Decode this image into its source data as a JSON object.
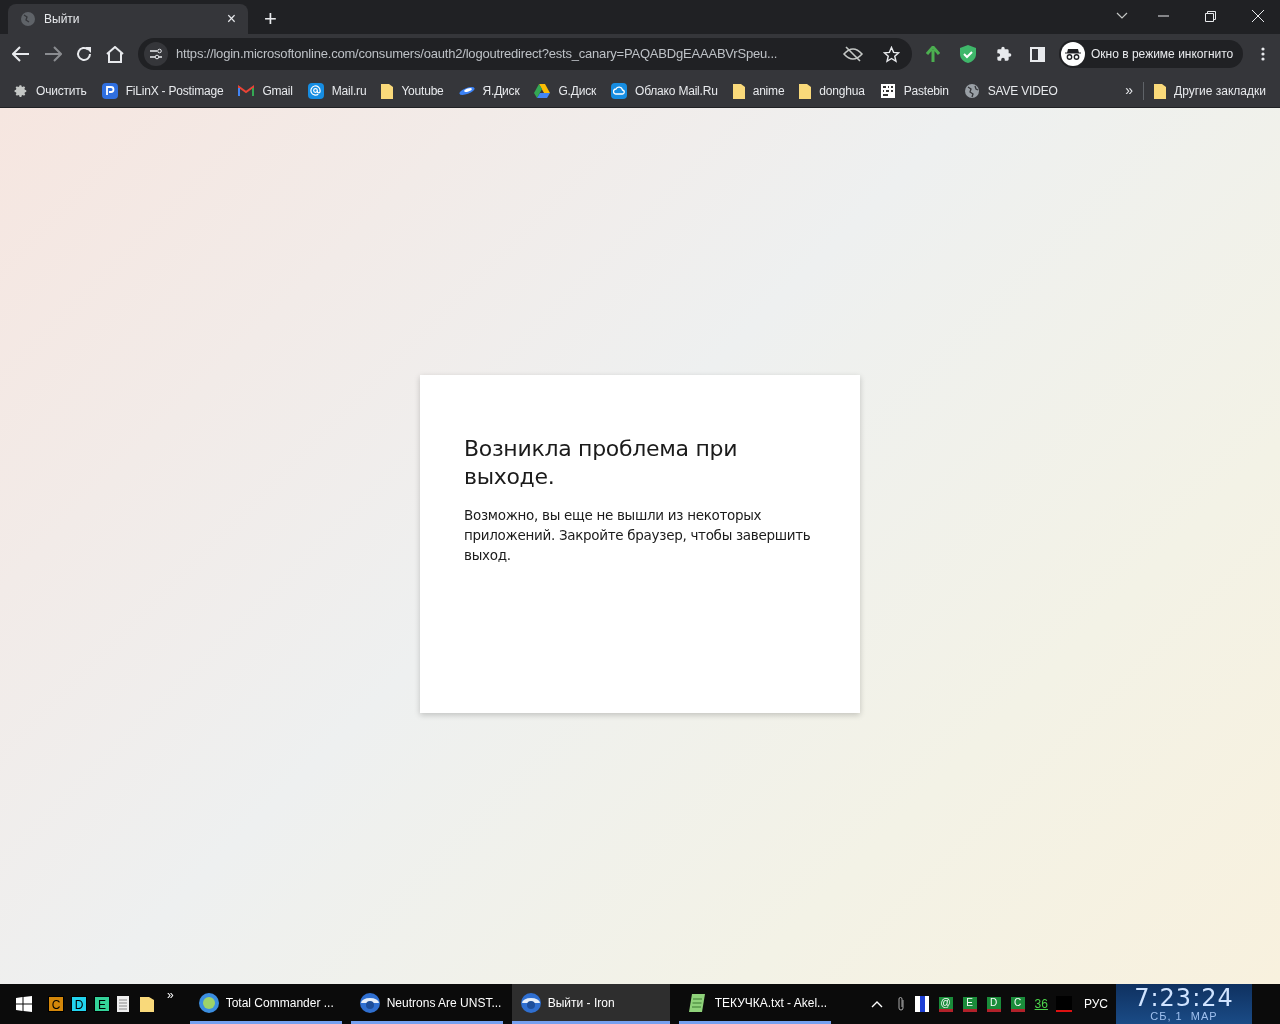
{
  "tabs": [
    {
      "title": "Выйти",
      "close": "×",
      "selected": true
    }
  ],
  "new_tab": "+",
  "address_bar": {
    "url": "https://login.microsoftonline.com/consumers/oauth2/logoutredirect?ests_canary=PAQABDgEAAABVrSpeu..."
  },
  "incognito_label": "Окно в режиме инкогнито",
  "bookmarks": [
    {
      "label": "Очистить",
      "kind": "gear"
    },
    {
      "label": "FiLinX - Postimage",
      "kind": "postimage"
    },
    {
      "label": "Gmail",
      "kind": "gmail"
    },
    {
      "label": "Mail.ru",
      "kind": "mailru"
    },
    {
      "label": "Youtube",
      "kind": "folder"
    },
    {
      "label": "Я.Диск",
      "kind": "ydisk"
    },
    {
      "label": "G.Диск",
      "kind": "gdrive"
    },
    {
      "label": "Облако Mail.Ru",
      "kind": "cloud"
    },
    {
      "label": "anime",
      "kind": "folder"
    },
    {
      "label": "donghua",
      "kind": "folder"
    },
    {
      "label": "Pastebin",
      "kind": "pastebin"
    },
    {
      "label": "SAVE VIDEO",
      "kind": "globe"
    }
  ],
  "bookmarks_overflow": "»",
  "other_bookmarks": "Другие закладки",
  "card": {
    "heading": "Возникла проблема при выходе.",
    "message": "Возможно, вы еще не вышли из некоторых приложений. Закройте браузер, чтобы завершить выход."
  },
  "taskbar": {
    "quick_launch": [
      {
        "label": "C",
        "color": "#d4870a"
      },
      {
        "label": "D",
        "color": "#22d3ee"
      },
      {
        "label": "E",
        "color": "#34d399"
      }
    ],
    "quick_overflow": "»",
    "windows": [
      {
        "title": "Total Commander ...",
        "kind": "tc",
        "selected": false
      },
      {
        "title": "Neutrons Are UNST...",
        "kind": "iron",
        "selected": false
      },
      {
        "title": "Выйти - Iron",
        "kind": "iron",
        "selected": true
      },
      {
        "title": "ТЕКУЧКА.txt - Akel...",
        "kind": "notepad",
        "selected": false
      }
    ],
    "tray_drives": [
      "@",
      "E",
      "D",
      "C"
    ],
    "tray_number": "36",
    "language": "РУС",
    "time": "7:23:24",
    "date": "СБ, 1  МАР"
  }
}
